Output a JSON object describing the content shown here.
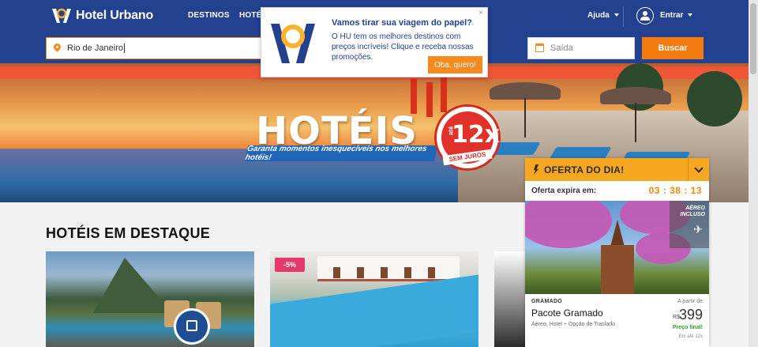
{
  "header": {
    "brand": "Hotel Urbano",
    "nav": [
      "DESTINOS",
      "HOTÉ"
    ],
    "help": "Ajuda",
    "login": "Entrar"
  },
  "search": {
    "destination_value": "Rio de Janeiro",
    "checkout_placeholder": "Saída",
    "button": "Buscar"
  },
  "hero": {
    "title": "HOTÉIS",
    "subtitle": "Garanta momentos inesquecíveis nos melhores hotéis!",
    "badge_prefix": "até",
    "badge_value": "12x",
    "badge_suffix": "SEM JUROS"
  },
  "section": {
    "title": "HOTÉIS EM DESTAQUE",
    "cards": [
      {
        "badge": ""
      },
      {
        "badge": "-5%"
      },
      {
        "badge": ""
      }
    ]
  },
  "popup": {
    "title": "Vamos tirar sua viagem do papel?",
    "text": "O HU tem os melhores destinos com preços incríveis! Clique e receba nossas promoções.",
    "button": "Oba, quero!",
    "close": "×"
  },
  "offer": {
    "title": "OFERTA DO DIA!",
    "expires_label": "Oferta expira em:",
    "timer": "03 : 38 : 13",
    "air_tag_line1": "AÉREO",
    "air_tag_line2": "INCLUSO",
    "destination": "GRAMADO",
    "from_label": "A partir de",
    "package_name": "Pacote Gramado",
    "package_desc": "Aéreo, Hotel + Opção de Traslado",
    "currency": "R$",
    "price": "399",
    "final_label": "Preço final!",
    "installments": "Em até 12x"
  },
  "colors": {
    "brand_blue": "#24418f",
    "accent_orange": "#f58a1f",
    "offer_yellow": "#f7a823"
  }
}
